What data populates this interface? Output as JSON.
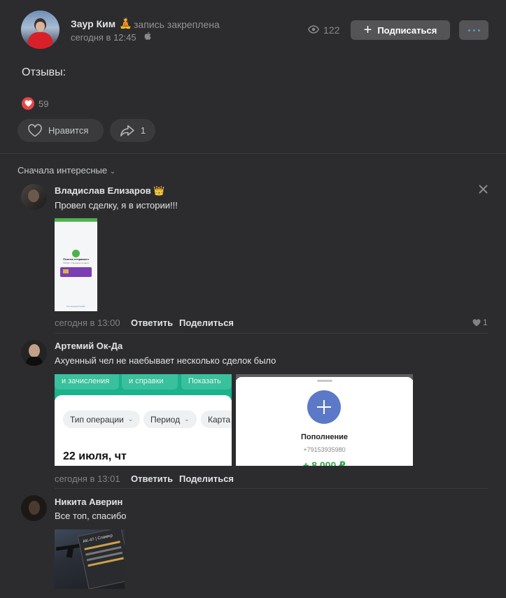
{
  "post": {
    "author": "Заур Ким",
    "author_emoji": "🧘",
    "pinned_label": "запись закреплена",
    "time": "сегодня в 12:45",
    "views": "122",
    "subscribe_label": "Подписаться",
    "text": "Отзывы:",
    "reactions_count": "59",
    "like_label": "Нравится",
    "share_count": "1"
  },
  "comments_sort": "Сначала интересные",
  "comments": [
    {
      "author": "Владислав Елизаров",
      "author_emoji": "👑",
      "text": "Провел сделку, я в истории!!!",
      "time": "сегодня в 13:00",
      "reply_label": "Ответить",
      "share_label": "Поделиться",
      "likes": "1",
      "attachment": {
        "title": "Платеж отправлен",
        "subtitle": "TRUST • Перевод по карте",
        "link": "Поставщикий файл"
      }
    },
    {
      "author": "Артемий Ок-Да",
      "text": "Ахуенный чел не наебывает несколько сделок было",
      "time": "сегодня в 13:01",
      "reply_label": "Ответить",
      "share_label": "Поделиться",
      "attachment_bank": {
        "top_chips": [
          "и зачисления",
          "и справки",
          "Показать"
        ],
        "filters": [
          "Тип операции",
          "Период",
          "Карта"
        ],
        "date": "22 июля, чт"
      },
      "attachment_topup": {
        "title": "Пополнение",
        "phone": "+79153935980",
        "amount": "+ 8 000 ₽"
      }
    },
    {
      "author": "Никита Аверин",
      "text": "Все топ, спасибо",
      "attachment_game": {
        "title": "AK-47 | Спамер"
      }
    }
  ],
  "colors": {
    "background": "#2c2c2e",
    "button": "#545457",
    "heart": "#e64646",
    "accent": "#6a8fc4"
  }
}
